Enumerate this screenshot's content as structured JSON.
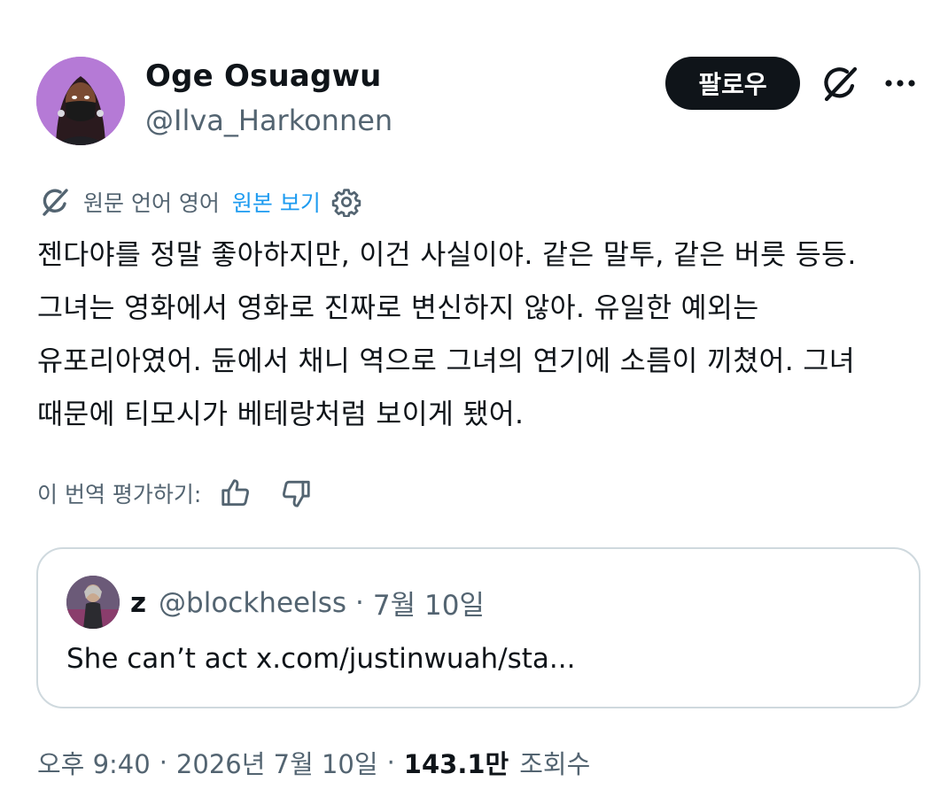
{
  "author": {
    "name": "Oge Osuagwu",
    "handle": "@Ilva_Harkonnen"
  },
  "actions": {
    "follow_label": "팔로우",
    "grok_icon": "grok-icon",
    "more_icon": "more-icon"
  },
  "translation": {
    "source_language": "원문 언어 영어",
    "show_original": "원본 보기",
    "icon": "grok-translate-icon",
    "settings_icon": "gear-icon"
  },
  "tweet": {
    "text": "젠다야를 정말 좋아하지만, 이건 사실이야. 같은 말투, 같은 버릇 등등. 그녀는 영화에서 영화로 진짜로 변신하지 않아. 유일한 예외는 유포리아였어. 듄에서 채니 역으로 그녀의 연기에 소름이 끼쳤어. 그녀 때문에 티모시가 베테랑처럼 보이게 됐어."
  },
  "rating": {
    "label": "이 번역 평가하기:",
    "up_icon": "thumbs-up-icon",
    "down_icon": "thumbs-down-icon"
  },
  "quote": {
    "name": "z",
    "handle": "@blockheelss",
    "separator": "·",
    "date": "7월 10일",
    "text": "She can’t act x.com/justinwuah/sta..."
  },
  "meta": {
    "time": "오후 9:40",
    "separator": "·",
    "date": "2026년 7월 10일",
    "views_count": "143.1만",
    "views_label": "조회수"
  },
  "colors": {
    "text": "#0f1419",
    "secondary": "#536471",
    "link": "#1d9bf0",
    "border": "#cfd9de"
  }
}
